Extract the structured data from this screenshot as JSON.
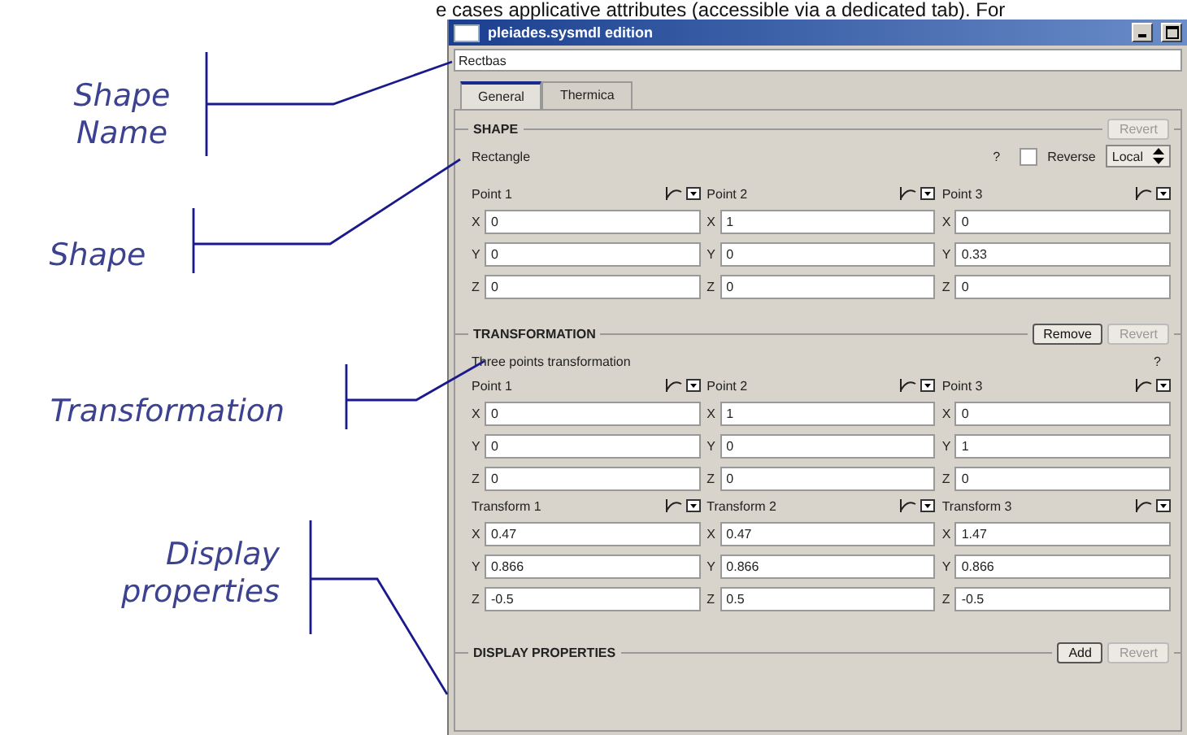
{
  "page_text": "e cases applicative attributes (accessible via a dedicated tab). For",
  "annotations": [
    {
      "label": "Shape Name"
    },
    {
      "label": "Shape"
    },
    {
      "label": "Transformation"
    },
    {
      "label": "Display properties"
    }
  ],
  "window": {
    "title": "pleiades.sysmdl edition"
  },
  "name_field": {
    "value": "Rectbas"
  },
  "tabs": [
    {
      "label": "General",
      "selected": true
    },
    {
      "label": "Thermica",
      "selected": false
    }
  ],
  "sections": [
    {
      "kind": "shape",
      "title": "SHAPE",
      "buttons": [
        {
          "label": "Revert",
          "disabled": true
        }
      ],
      "description": "Rectangle",
      "help": "?",
      "reverse": {
        "label": "Reverse",
        "checked": false
      },
      "frame": "Local",
      "groups": [
        {
          "points": [
            {
              "label": "Point 1",
              "fields": [
                {
                  "axis": "X",
                  "value": "0"
                },
                {
                  "axis": "Y",
                  "value": "0"
                },
                {
                  "axis": "Z",
                  "value": "0"
                }
              ]
            },
            {
              "label": "Point 2",
              "fields": [
                {
                  "axis": "X",
                  "value": "1"
                },
                {
                  "axis": "Y",
                  "value": "0"
                },
                {
                  "axis": "Z",
                  "value": "0"
                }
              ]
            },
            {
              "label": "Point 3",
              "fields": [
                {
                  "axis": "X",
                  "value": "0"
                },
                {
                  "axis": "Y",
                  "value": "0.33"
                },
                {
                  "axis": "Z",
                  "value": "0"
                }
              ]
            }
          ]
        }
      ]
    },
    {
      "kind": "transformation",
      "title": "TRANSFORMATION",
      "buttons": [
        {
          "label": "Remove",
          "disabled": false
        },
        {
          "label": "Revert",
          "disabled": true
        }
      ],
      "description": "Three points transformation",
      "help": "?",
      "groups": [
        {
          "points": [
            {
              "label": "Point 1",
              "fields": [
                {
                  "axis": "X",
                  "value": "0"
                },
                {
                  "axis": "Y",
                  "value": "0"
                },
                {
                  "axis": "Z",
                  "value": "0"
                }
              ]
            },
            {
              "label": "Point 2",
              "fields": [
                {
                  "axis": "X",
                  "value": "1"
                },
                {
                  "axis": "Y",
                  "value": "0"
                },
                {
                  "axis": "Z",
                  "value": "0"
                }
              ]
            },
            {
              "label": "Point 3",
              "fields": [
                {
                  "axis": "X",
                  "value": "0"
                },
                {
                  "axis": "Y",
                  "value": "1"
                },
                {
                  "axis": "Z",
                  "value": "0"
                }
              ]
            }
          ]
        },
        {
          "points": [
            {
              "label": "Transform 1",
              "fields": [
                {
                  "axis": "X",
                  "value": "0.47"
                },
                {
                  "axis": "Y",
                  "value": "0.866"
                },
                {
                  "axis": "Z",
                  "value": "-0.5"
                }
              ]
            },
            {
              "label": "Transform 2",
              "fields": [
                {
                  "axis": "X",
                  "value": "0.47"
                },
                {
                  "axis": "Y",
                  "value": "0.866"
                },
                {
                  "axis": "Z",
                  "value": "0.5"
                }
              ]
            },
            {
              "label": "Transform 3",
              "fields": [
                {
                  "axis": "X",
                  "value": "1.47"
                },
                {
                  "axis": "Y",
                  "value": "0.866"
                },
                {
                  "axis": "Z",
                  "value": "-0.5"
                }
              ]
            }
          ]
        }
      ]
    },
    {
      "kind": "display",
      "title": "DISPLAY PROPERTIES",
      "buttons": [
        {
          "label": "Add",
          "disabled": false
        },
        {
          "label": "Revert",
          "disabled": true
        }
      ]
    }
  ]
}
